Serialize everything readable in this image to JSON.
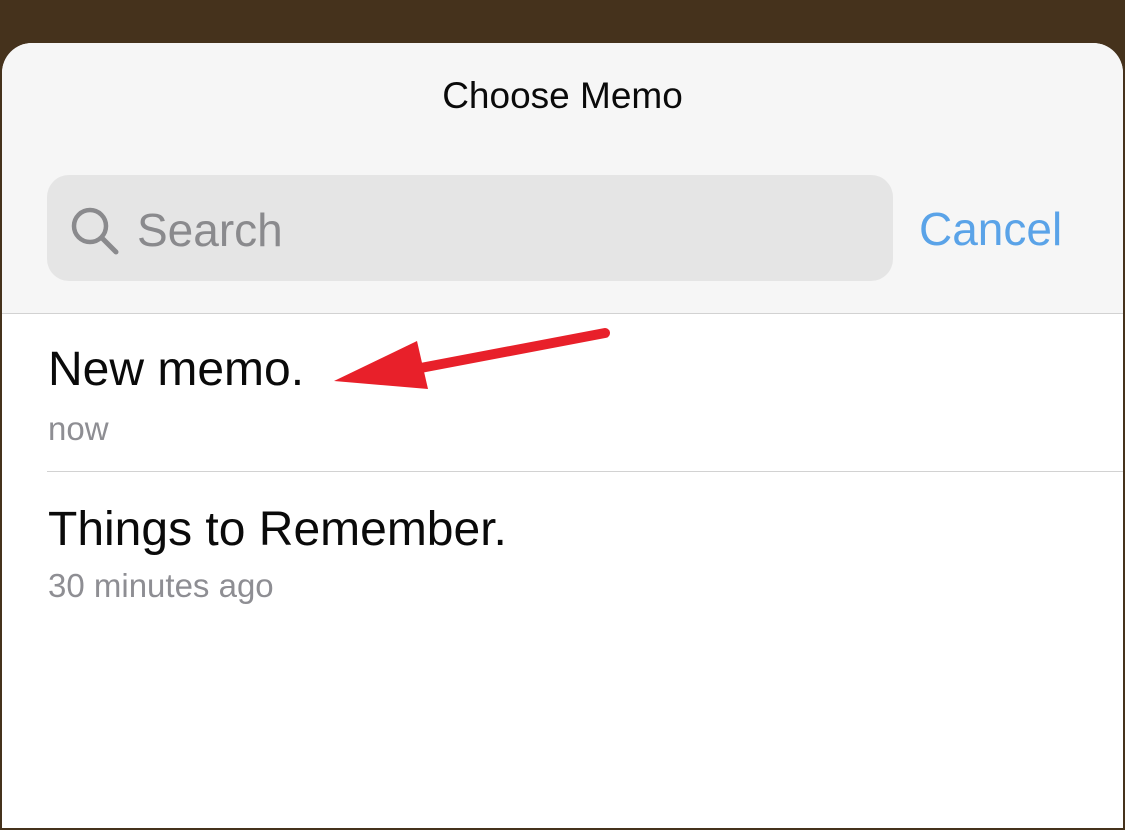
{
  "colors": {
    "backdrop": "#45321c",
    "sheet_background": "#ffffff",
    "header_background": "#f6f6f6",
    "accent_blue": "#5aa3e8",
    "secondary_text": "#8e8e93",
    "annotation_arrow": "#e8202a"
  },
  "header": {
    "title": "Choose Memo"
  },
  "search": {
    "icon": "search-icon",
    "placeholder": "Search",
    "value": ""
  },
  "cancel_label": "Cancel",
  "memos": [
    {
      "title": "New memo.",
      "subtitle": "now"
    },
    {
      "title": "Things to Remember.",
      "subtitle": "30 minutes ago"
    }
  ],
  "annotation": {
    "type": "red-arrow",
    "points_to": "New memo."
  }
}
